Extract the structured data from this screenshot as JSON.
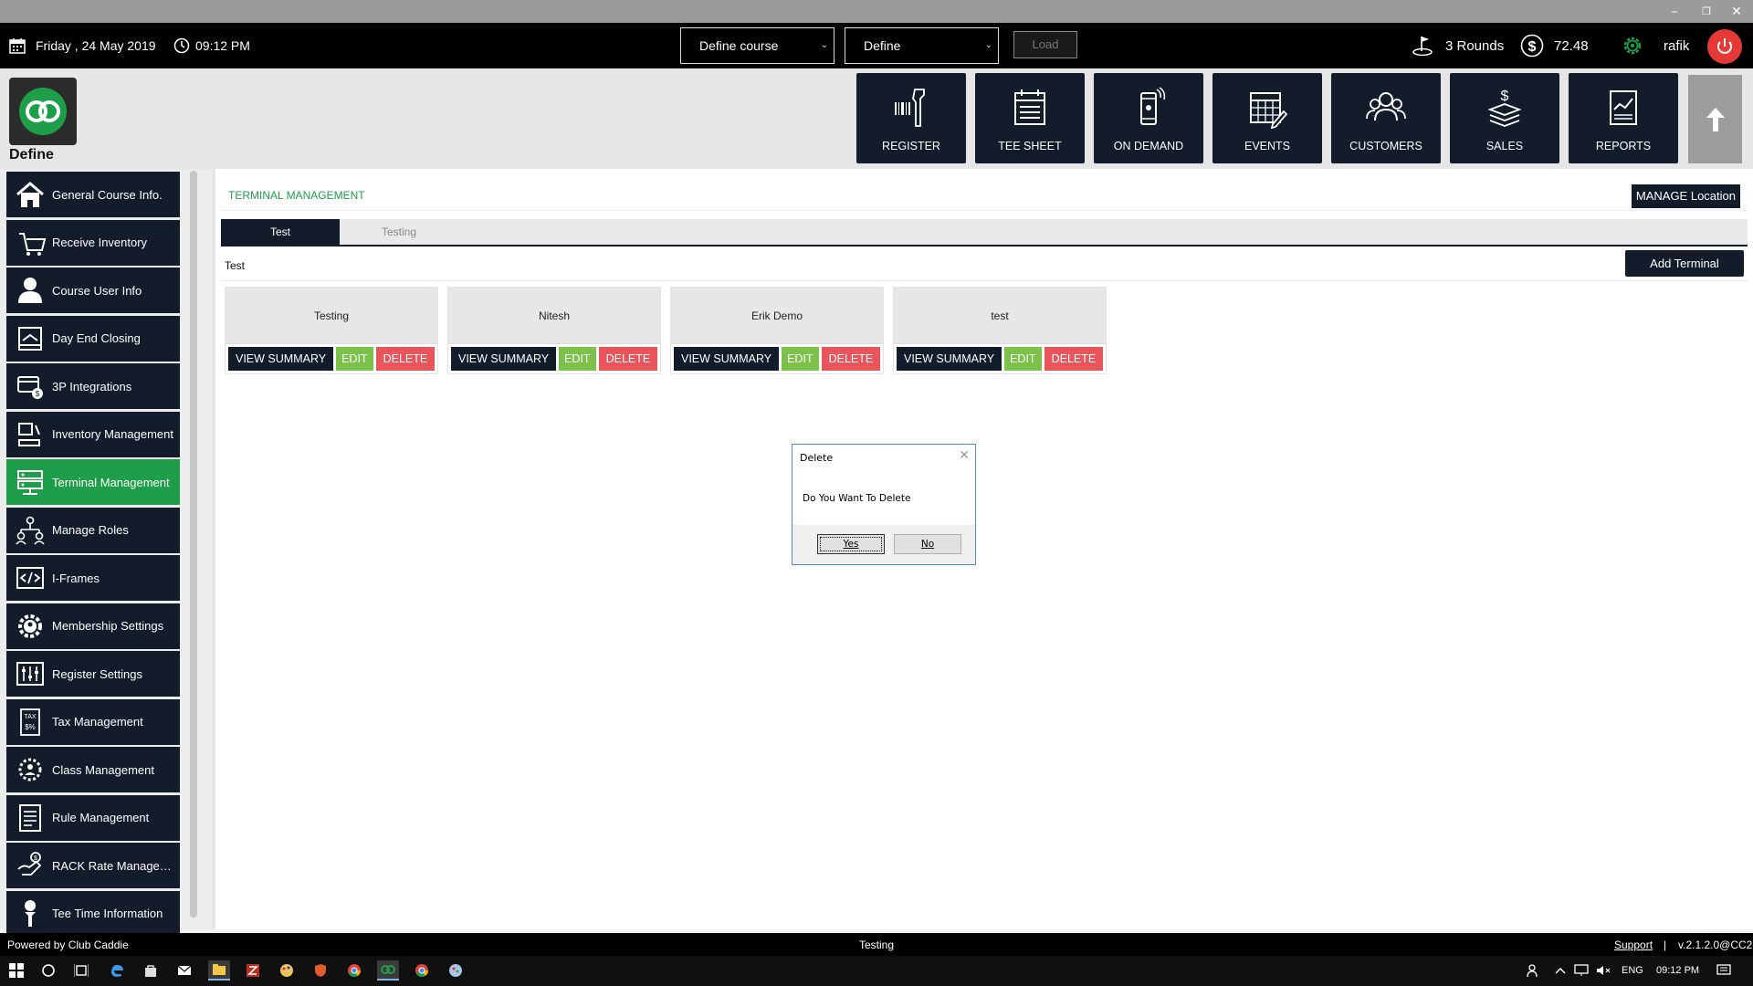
{
  "window_controls": {
    "minimize": "–",
    "restore": "❐",
    "close": "✕"
  },
  "topbar": {
    "date": "Friday ,  24 May 2019",
    "time": "09:12 PM",
    "course_select": "Define course",
    "define_select": "Define",
    "load_label": "Load",
    "rounds": "3 Rounds",
    "balance": "72.48",
    "user": "rafik"
  },
  "brand": {
    "label": "Define"
  },
  "nav": [
    {
      "label": "REGISTER",
      "icon": "barcode-scanner-icon"
    },
    {
      "label": "TEE SHEET",
      "icon": "tee-sheet-icon"
    },
    {
      "label": "ON DEMAND",
      "icon": "mobile-icon"
    },
    {
      "label": "EVENTS",
      "icon": "calendar-icon"
    },
    {
      "label": "CUSTOMERS",
      "icon": "customers-icon"
    },
    {
      "label": "SALES",
      "icon": "sales-icon"
    },
    {
      "label": "REPORTS",
      "icon": "reports-icon"
    }
  ],
  "sidebar": [
    {
      "label": "General Course Info.",
      "icon": "home-icon"
    },
    {
      "label": "Receive Inventory",
      "icon": "cart-icon"
    },
    {
      "label": "Course User Info",
      "icon": "user-icon"
    },
    {
      "label": "Day End Closing",
      "icon": "register-close-icon"
    },
    {
      "label": "3P Integrations",
      "icon": "integration-icon"
    },
    {
      "label": "Inventory Management",
      "icon": "inventory-icon"
    },
    {
      "label": "Terminal Management",
      "icon": "terminal-icon",
      "active": true
    },
    {
      "label": "Manage Roles",
      "icon": "roles-icon"
    },
    {
      "label": "I-Frames",
      "icon": "code-icon"
    },
    {
      "label": "Membership Settings",
      "icon": "membership-gear-icon"
    },
    {
      "label": "Register Settings",
      "icon": "register-settings-icon"
    },
    {
      "label": "Tax Management",
      "icon": "tax-icon"
    },
    {
      "label": "Class Management",
      "icon": "class-gear-icon"
    },
    {
      "label": "Rule Management",
      "icon": "rules-icon"
    },
    {
      "label": "RACK Rate Manageme...",
      "icon": "rack-rate-icon"
    },
    {
      "label": "Tee Time Information",
      "icon": "golf-tee-icon"
    }
  ],
  "main": {
    "title": "TERMINAL MANAGEMENT",
    "manage_location": "MANAGE Location",
    "tabs": [
      {
        "label": "Test",
        "active": true
      },
      {
        "label": "Testing",
        "active": false
      }
    ],
    "section_label": "Test",
    "add_terminal": "Add Terminal",
    "button_labels": {
      "view": "VIEW SUMMARY",
      "edit": "EDIT",
      "delete": "DELETE"
    },
    "terminals": [
      {
        "name": "Testing"
      },
      {
        "name": "Nitesh"
      },
      {
        "name": "Erik Demo"
      },
      {
        "name": "test"
      }
    ]
  },
  "dialog": {
    "title": "Delete",
    "message": "Do You Want To Delete",
    "yes": "Yes",
    "no": "No",
    "close": "✕"
  },
  "statusbar": {
    "powered_by": "Powered by Club Caddie",
    "center": "Testing",
    "support": "Support",
    "separator": "|",
    "version": "v.2.1.2.0@CC2"
  },
  "taskbar": {
    "lang": "ENG",
    "time": "09:12 PM"
  },
  "colors": {
    "dark": "#131c2a",
    "green": "#1e9e48",
    "edit": "#7cc24a",
    "delete": "#e8555a",
    "power": "#e53935"
  }
}
